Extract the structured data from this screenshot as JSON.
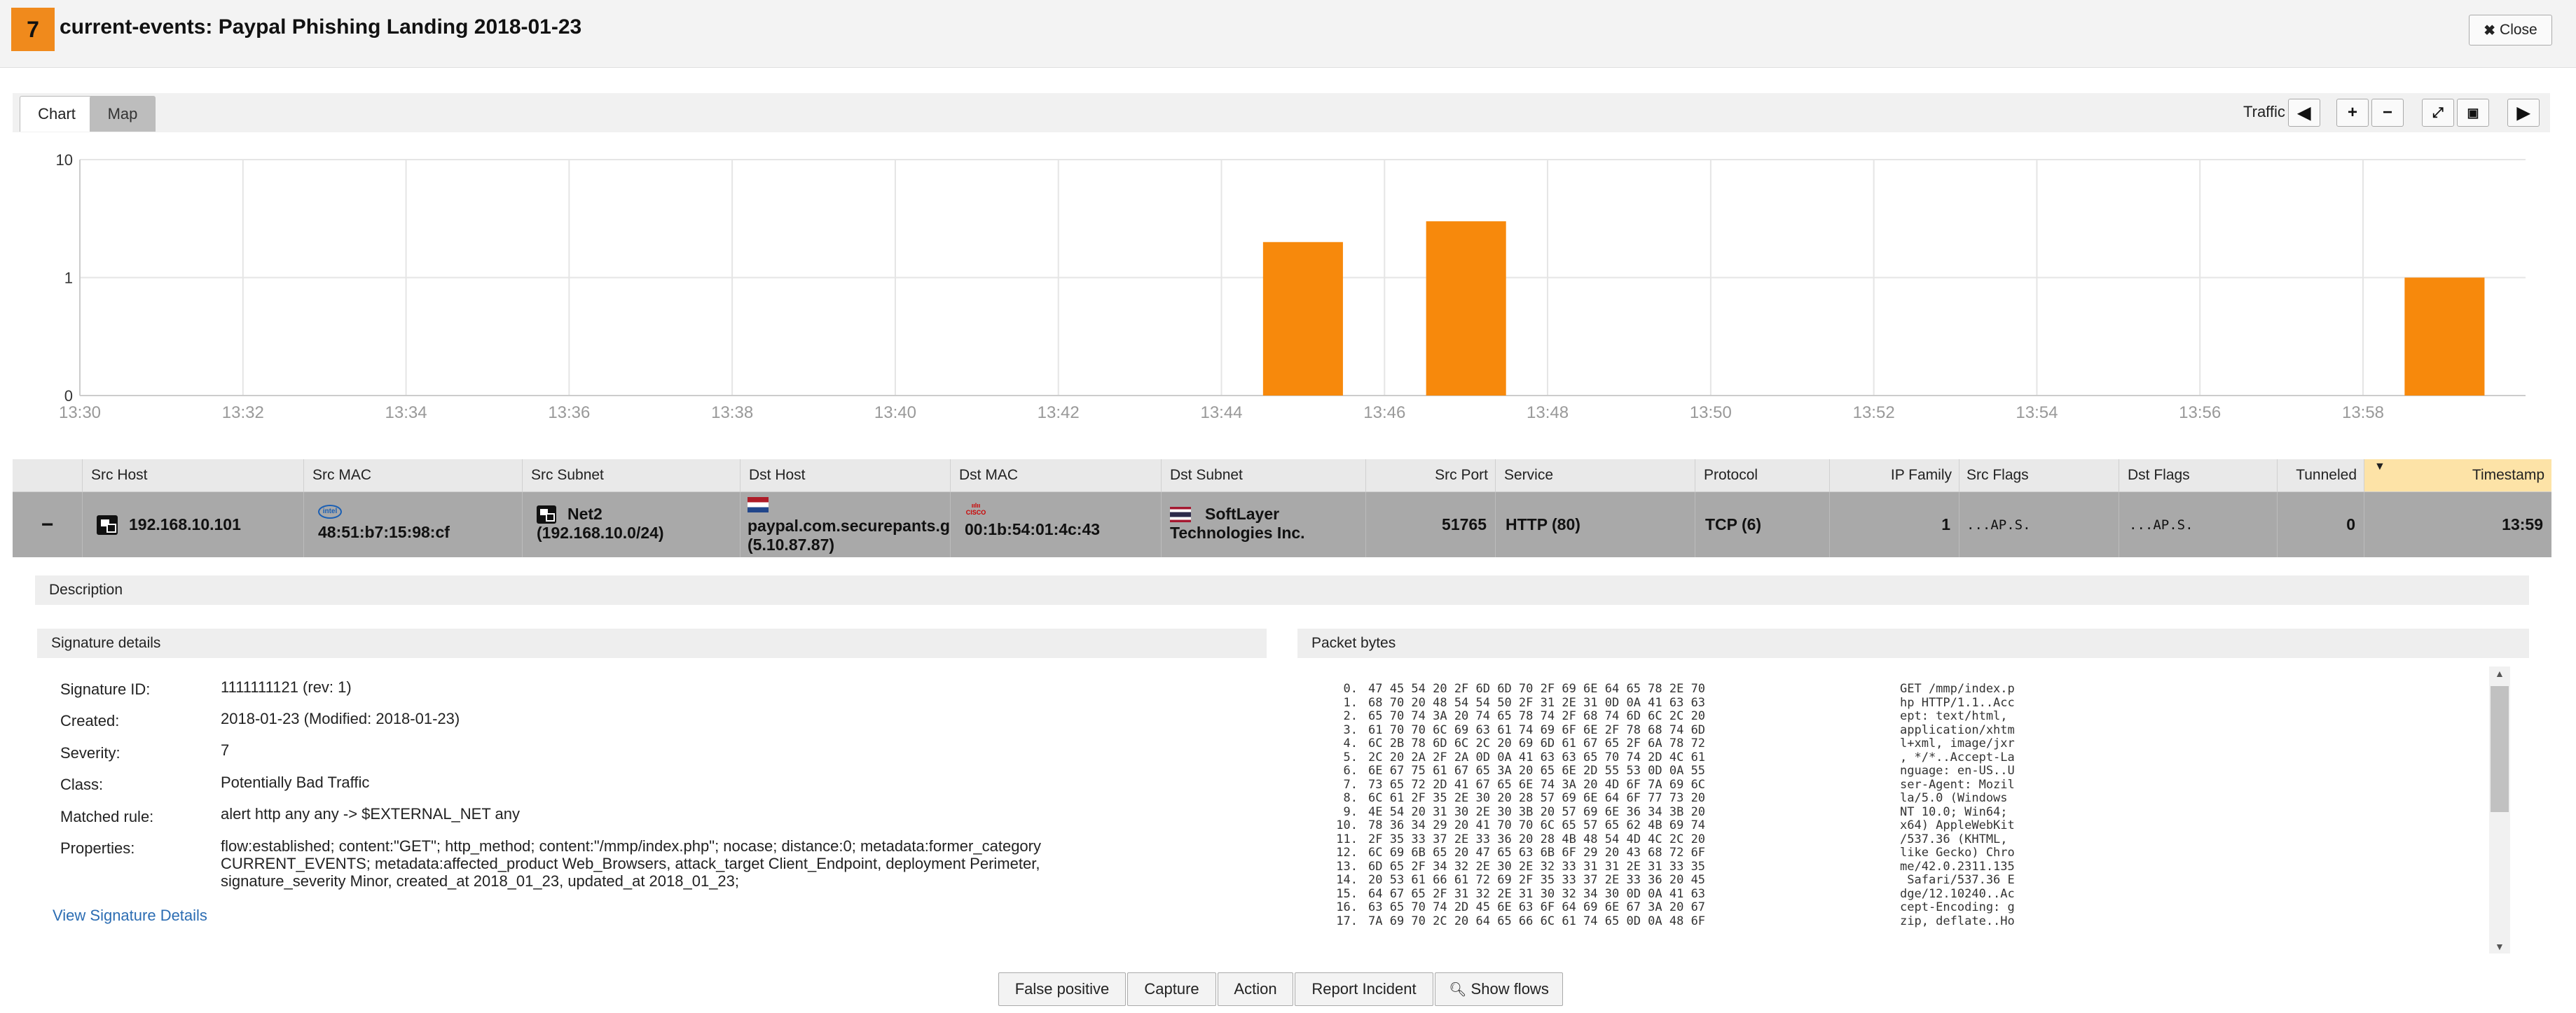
{
  "header": {
    "severity": "7",
    "title": "current-events: Paypal Phishing Landing 2018-01-23",
    "close_label": "Close"
  },
  "tabs": [
    {
      "label": "Chart"
    },
    {
      "label": "Map"
    }
  ],
  "toolbar": {
    "traffic_label": "Traffic"
  },
  "chart_data": {
    "type": "bar",
    "x_ticks": [
      "13:30",
      "13:32",
      "13:34",
      "13:36",
      "13:38",
      "13:40",
      "13:42",
      "13:44",
      "13:46",
      "13:48",
      "13:50",
      "13:52",
      "13:54",
      "13:56",
      "13:58"
    ],
    "y_ticks": [
      "0",
      "1",
      "10"
    ],
    "yscale": "log",
    "bars": [
      {
        "x": "13:45",
        "y": 2
      },
      {
        "x": "13:47",
        "y": 3
      },
      {
        "x": "13:59",
        "y": 1
      }
    ],
    "color": "#f7890c",
    "grid": true
  },
  "table": {
    "columns": [
      "Src Host",
      "Src MAC",
      "Src Subnet",
      "Dst Host",
      "Dst MAC",
      "Dst Subnet",
      "Src Port",
      "Service",
      "Protocol",
      "IP Family",
      "Src Flags",
      "Dst Flags",
      "Tunneled",
      "Timestamp"
    ],
    "row": {
      "expand": "−",
      "src_host": "192.168.10.101",
      "src_mac": "48:51:b7:15:98:cf",
      "src_subnet_name": "Net2",
      "src_subnet_cidr": "(192.168.10.0/24)",
      "dst_host": "paypal.com.securepants.g",
      "dst_ip": "(5.10.87.87)",
      "dst_mac": "00:1b:54:01:4c:43",
      "dst_subnet_line1": "SoftLayer",
      "dst_subnet_line2": "Technologies Inc.",
      "src_port": "51765",
      "service": "HTTP (80)",
      "protocol": "TCP (6)",
      "ip_family": "1",
      "src_flags": "...AP.S.",
      "dst_flags": "...AP.S.",
      "tunneled": "0",
      "timestamp": "13:59",
      "src_mac_vendor": "intel",
      "dst_mac_vendor": "cisco"
    }
  },
  "detail": {
    "description_heading": "Description",
    "signature_heading": "Signature details",
    "packet_heading": "Packet bytes",
    "labels": {
      "sid": "Signature ID:",
      "created": "Created:",
      "severity": "Severity:",
      "class": "Class:",
      "matched": "Matched rule:",
      "properties": "Properties:"
    },
    "values": {
      "sid": "1111111121 (rev: 1)",
      "created": "2018-01-23 (Modified: 2018-01-23)",
      "severity": "7",
      "class": "Potentially Bad Traffic",
      "matched": "alert http any any -> $EXTERNAL_NET any",
      "properties_1": "flow:established; content:\"GET\"; http_method; content:\"/mmp/index.php\"; nocase; distance:0; metadata:former_category",
      "properties_2": "CURRENT_EVENTS; metadata:affected_product Web_Browsers, attack_target Client_Endpoint, deployment Perimeter,",
      "properties_3": "signature_severity Minor, created_at 2018_01_23, updated_at 2018_01_23;"
    },
    "view_link": "View Signature Details",
    "packet_offsets": "0.\n1.\n2.\n3.\n4.\n5.\n6.\n7.\n8.\n9.\n10.\n11.\n12.\n13.\n14.\n15.\n16.\n17.",
    "packet_hex": "47 45 54 20 2F 6D 6D 70 2F 69 6E 64 65 78 2E 70\n68 70 20 48 54 54 50 2F 31 2E 31 0D 0A 41 63 63\n65 70 74 3A 20 74 65 78 74 2F 68 74 6D 6C 2C 20\n61 70 70 6C 69 63 61 74 69 6F 6E 2F 78 68 74 6D\n6C 2B 78 6D 6C 2C 20 69 6D 61 67 65 2F 6A 78 72\n2C 20 2A 2F 2A 0D 0A 41 63 63 65 70 74 2D 4C 61\n6E 67 75 61 67 65 3A 20 65 6E 2D 55 53 0D 0A 55\n73 65 72 2D 41 67 65 6E 74 3A 20 4D 6F 7A 69 6C\n6C 61 2F 35 2E 30 20 28 57 69 6E 64 6F 77 73 20\n4E 54 20 31 30 2E 30 3B 20 57 69 6E 36 34 3B 20\n78 36 34 29 20 41 70 70 6C 65 57 65 62 4B 69 74\n2F 35 33 37 2E 33 36 20 28 4B 48 54 4D 4C 2C 20\n6C 69 6B 65 20 47 65 63 6B 6F 29 20 43 68 72 6F\n6D 65 2F 34 32 2E 30 2E 32 33 31 31 2E 31 33 35\n20 53 61 66 61 72 69 2F 35 33 37 2E 33 36 20 45\n64 67 65 2F 31 32 2E 31 30 32 34 30 0D 0A 41 63\n63 65 70 74 2D 45 6E 63 6F 64 69 6E 67 3A 20 67\n7A 69 70 2C 20 64 65 66 6C 61 74 65 0D 0A 48 6F",
    "packet_ascii": "GET /mmp/index.p\nhp HTTP/1.1..Acc\nept: text/html,\napplication/xhtm\nl+xml, image/jxr\n, */*..Accept-La\nnguage: en-US..U\nser-Agent: Mozil\nla/5.0 (Windows\nNT 10.0; Win64;\nx64) AppleWebKit\n/537.36 (KHTML,\nlike Gecko) Chro\nme/42.0.2311.135\n Safari/537.36 E\ndge/12.10240..Ac\ncept-Encoding: g\nzip, deflate..Ho"
  },
  "actions": {
    "false_positive": "False positive",
    "capture": "Capture",
    "action": "Action",
    "report": "Report Incident",
    "show_flows": "Show flows"
  }
}
